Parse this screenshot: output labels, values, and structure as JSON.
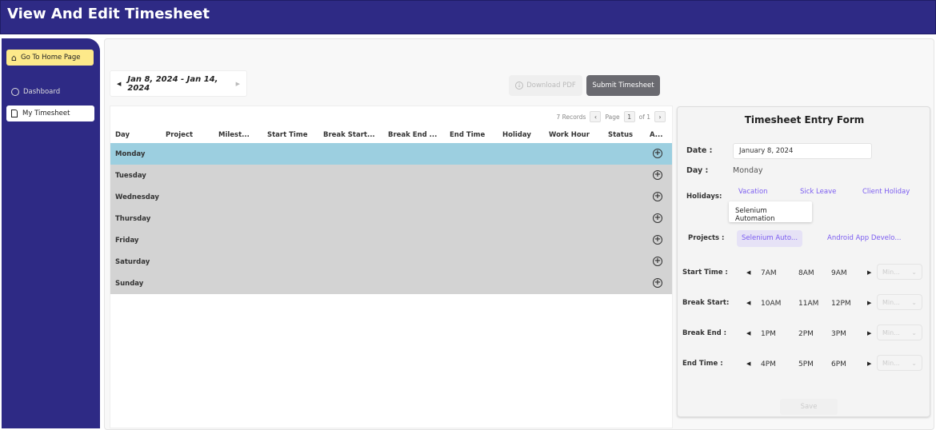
{
  "header": {
    "title": "View And Edit Timesheet"
  },
  "sidebar": {
    "home": "Go To Home Page",
    "items": [
      {
        "label": "Dashboard",
        "icon": "dashboard-icon"
      },
      {
        "label": "My Timesheet",
        "icon": "file-icon",
        "active": true
      }
    ]
  },
  "toolbar": {
    "date_range": "Jan 8, 2024 - Jan 14, 2024",
    "download": "Download PDF",
    "submit": "Submit Timesheet"
  },
  "table": {
    "records": "7 Records",
    "page_label": "Page",
    "page": "1",
    "of": "of 1",
    "columns": [
      "Day",
      "Project",
      "Milest...",
      "Start Time",
      "Break Start...",
      "Break End ...",
      "End Time",
      "Holiday",
      "Work Hour",
      "Status",
      "A..."
    ],
    "rows": [
      "Monday",
      "Tuesday",
      "Wednesday",
      "Thursday",
      "Friday",
      "Saturday",
      "Sunday"
    ],
    "selected": "Monday"
  },
  "form": {
    "title": "Timesheet Entry Form",
    "date_label": "Date :",
    "date_value": "January 8, 2024",
    "day_label": "Day :",
    "day_value": "Monday",
    "holidays_label": "Holidays:",
    "holidays": [
      "Vacation",
      "Sick Leave",
      "Client Holiday"
    ],
    "tooltip": "Selenium Automation",
    "projects_label": "Projects :",
    "projects": [
      "Selenium Auto...",
      "Android App Develo..."
    ],
    "times": [
      {
        "label": "Start Time :",
        "options": [
          "7AM",
          "8AM",
          "9AM"
        ]
      },
      {
        "label": "Break Start:",
        "options": [
          "10AM",
          "11AM",
          "12PM"
        ]
      },
      {
        "label": "Break End :",
        "options": [
          "1PM",
          "2PM",
          "3PM"
        ]
      },
      {
        "label": "End Time :",
        "options": [
          "4PM",
          "5PM",
          "6PM"
        ]
      }
    ],
    "minute_placeholder": "Min...",
    "save": "Save"
  },
  "colors": {
    "header": "#2e2a85",
    "home_button": "#fde98a",
    "selected_row": "#9ccfe0",
    "row": "#d3d3d3",
    "link": "#7b5cf0"
  }
}
